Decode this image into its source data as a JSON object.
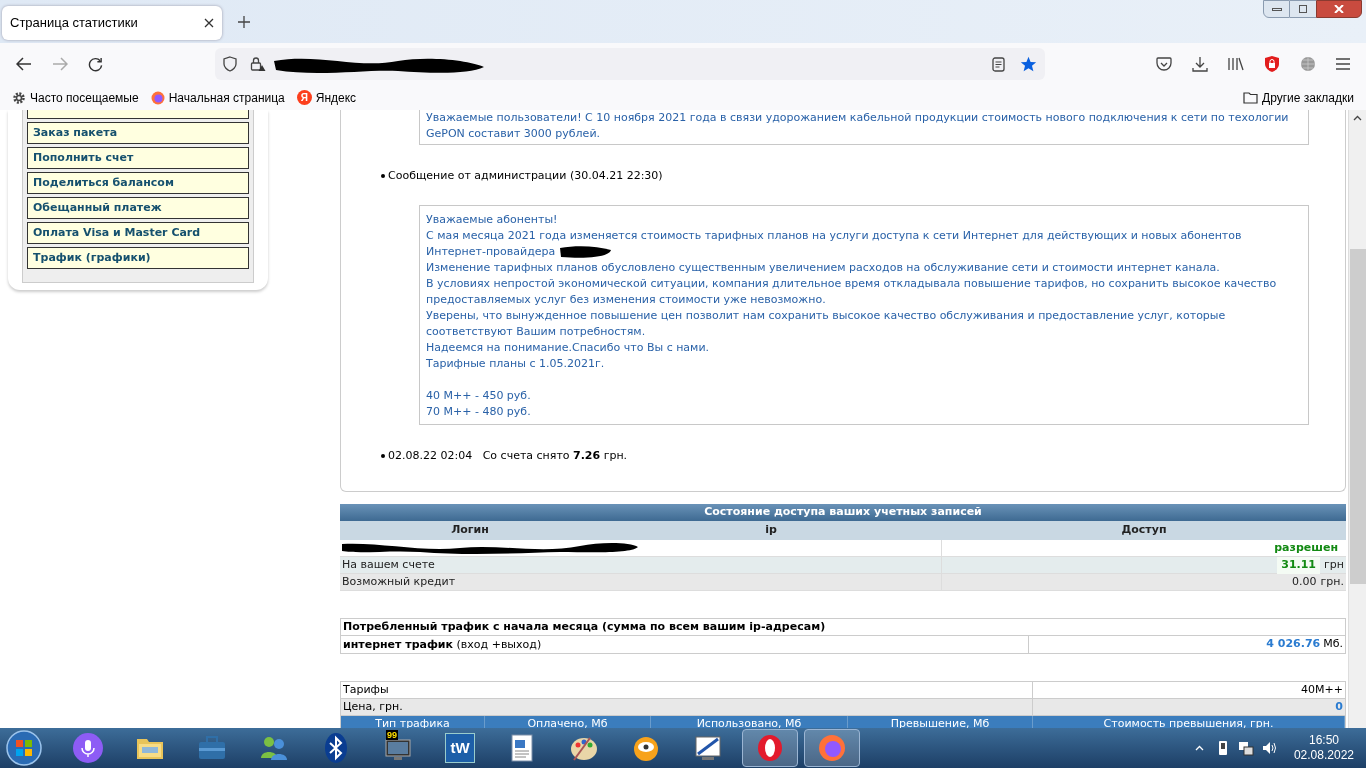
{
  "browser": {
    "tab": {
      "title": "Страница статистики",
      "selected": true
    },
    "bookmarks": [
      {
        "kind": "gear",
        "label": "Часто посещаемые"
      },
      {
        "kind": "firefox",
        "label": "Начальная страница"
      },
      {
        "kind": "yandex",
        "label": "Яндекс",
        "glyph": "Я"
      }
    ],
    "other_bookmarks": "Другие закладки"
  },
  "sidebar": {
    "items": [
      {
        "label": "Заказ пакета"
      },
      {
        "label": "Пополнить счет"
      },
      {
        "label": "Поделиться балансом"
      },
      {
        "label": "Обещанный платеж"
      },
      {
        "label": "Оплата Visa и Master Card"
      },
      {
        "label": "Трафик (графики)"
      }
    ]
  },
  "news": [
    {
      "kind": "box",
      "groups": [
        [
          {
            "text": "Уважаемые пользователи! С 10 ноября 2021 года в связи удорожанием кабельной продукции стоимость нового подключения к сети по техологии",
            "redacted": false
          },
          {
            "text": "GePON составит 3000 рублей.",
            "redacted": false
          }
        ]
      ]
    },
    {
      "kind": "bullet",
      "text": "Сообщение от администрации (30.04.21 22:30)"
    },
    {
      "kind": "box",
      "groups": [
        [
          {
            "text": "Уважаемые абоненты!",
            "redacted": false
          },
          {
            "text": "С мая месяца 2021 года изменяется стоимость тарифных планов на услуги доступа к сети Интернет для действующих и новых абонентов",
            "redacted": false
          },
          {
            "text": "Интернет-провайдера",
            "redacted": true
          },
          {
            "text": "Изменение тарифных планов обусловлено существенным увеличением расходов на обслуживание сети и стоимости интернет канала.",
            "redacted": false
          },
          {
            "text": "В условиях непростой экономической ситуации, компания длительное время откладывала повышение тарифов, но сохранить высокое качество",
            "redacted": false
          },
          {
            "text": "предоставляемых услуг без изменения стоимости уже невозможно.",
            "redacted": false
          },
          {
            "text": "Уверены, что вынужденное повышение цен позволит нам сохранить высокое качество обслуживания и предоставление услуг, которые",
            "redacted": false
          },
          {
            "text": "соответствуют Вашим потребностям.",
            "redacted": false
          },
          {
            "text": "Надеемся на понимание.Спасибо что Вы с нами.",
            "redacted": false
          },
          {
            "text": "Тарифные планы с 1.05.2021г.",
            "redacted": false
          }
        ],
        [
          {
            "text": "40 M++ - 450 руб.",
            "redacted": false
          },
          {
            "text": "70 M++ - 480 руб.",
            "redacted": false
          }
        ]
      ]
    },
    {
      "kind": "bullet",
      "text": "02.08.22 02:04   Со счета снято **7.26** грн."
    }
  ],
  "access": {
    "title": "Состояние доступа ваших учетных записей",
    "columns": [
      "Логин",
      "ip",
      "Доступ"
    ],
    "status": "разрешен",
    "rows": [
      {
        "label": "На вашем счете",
        "value": "31.11",
        "unit": "грн",
        "emphasis": true
      },
      {
        "label": "Возможный кредит",
        "value": "0.00",
        "unit": "грн.",
        "emphasis": false
      }
    ]
  },
  "traffic": {
    "title": "Потребленный трафик с начала месяца (сумма по всем вашим ip-адресам)",
    "label": "**интернет трафик** (вход +выход)",
    "value": "4 026.76",
    "unit": "Мб."
  },
  "tariffs": {
    "rows": [
      {
        "label": "Тарифы",
        "value": "40M++",
        "emphasis": false
      },
      {
        "label": "Цена, грн.",
        "value": "0",
        "emphasis": true
      }
    ],
    "columns": [
      "Тип трафика",
      "Оплачено, Мб",
      "Использовано, Мб",
      "Превышение, Мб",
      "Стоимость превышения, грн."
    ]
  },
  "taskbar": {
    "apps": [
      {
        "kind": "mic",
        "open": false
      },
      {
        "kind": "folder",
        "open": false
      },
      {
        "kind": "briefcase",
        "open": false
      },
      {
        "kind": "people",
        "open": false
      },
      {
        "kind": "bluetooth",
        "open": false
      },
      {
        "kind": "monitor",
        "badge": "99",
        "open": false
      },
      {
        "kind": "tile",
        "label": "tW",
        "open": false
      },
      {
        "kind": "document",
        "open": false
      },
      {
        "kind": "palette",
        "open": false
      },
      {
        "kind": "ball",
        "open": false
      },
      {
        "kind": "screen",
        "open": false
      },
      {
        "kind": "opera",
        "open": true
      },
      {
        "kind": "firefox",
        "open": true
      }
    ],
    "time": "16:50",
    "date": "02.08.2022"
  }
}
